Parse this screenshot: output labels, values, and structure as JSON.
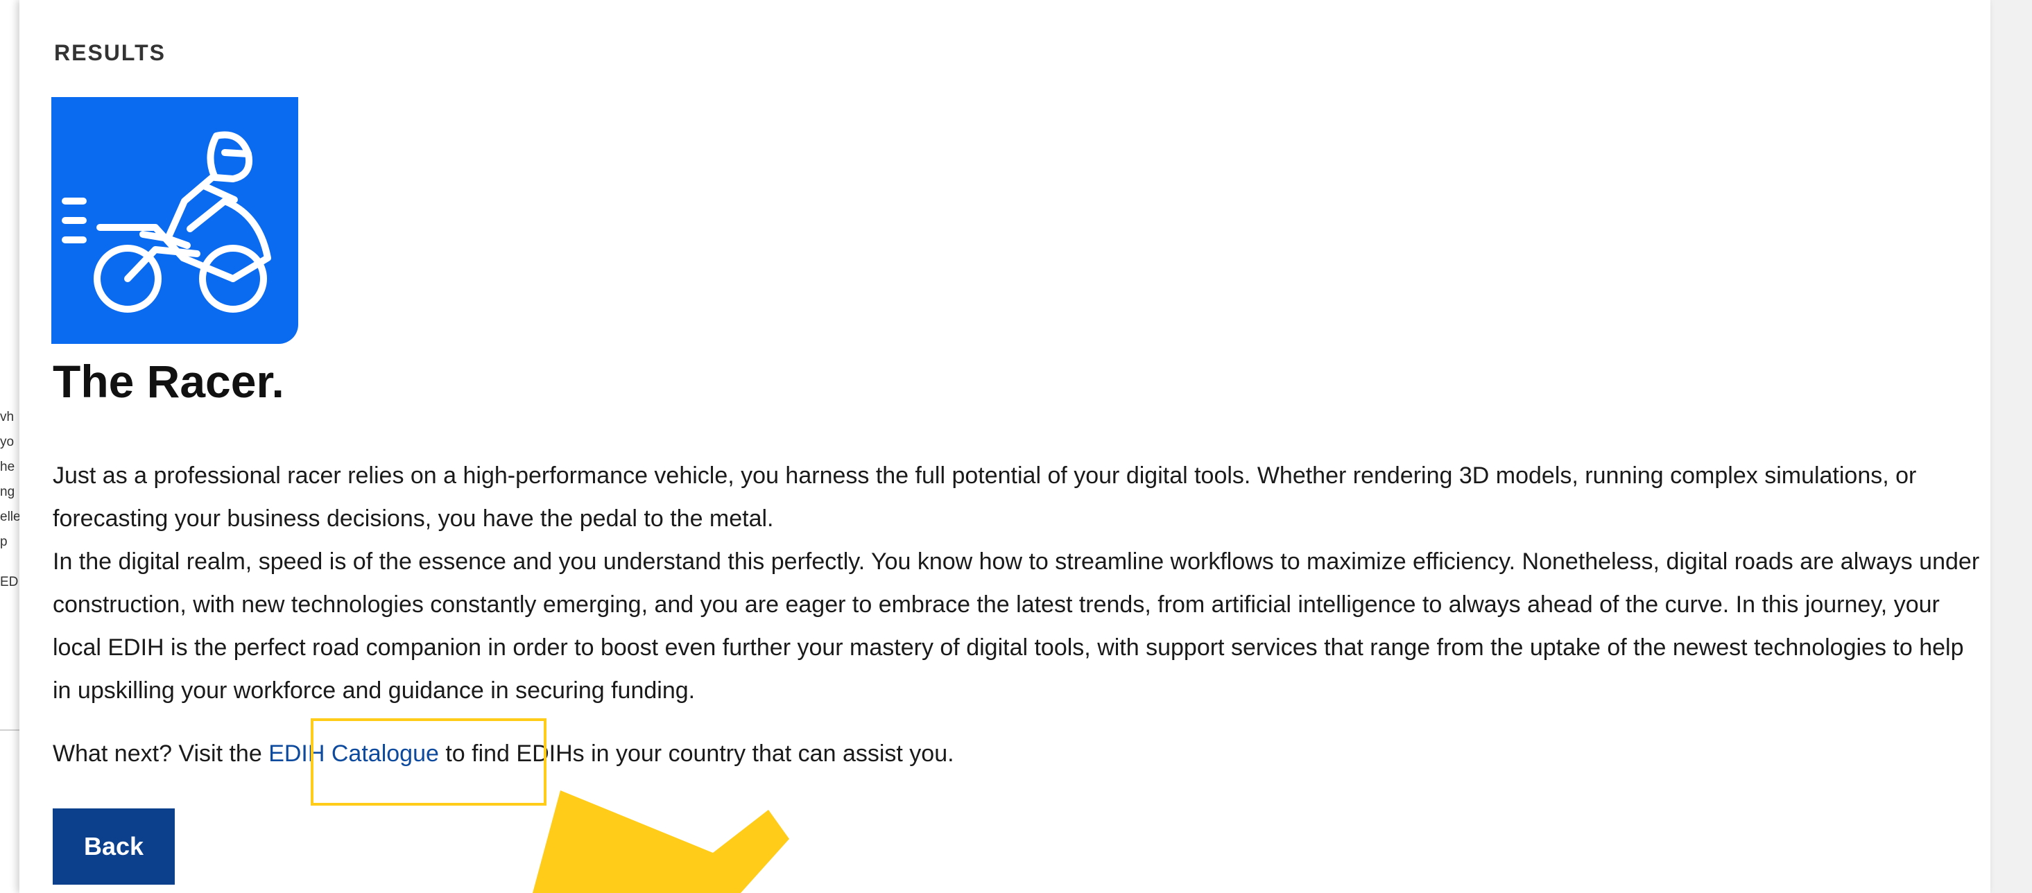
{
  "backdrop": {
    "fragments": [
      "vh",
      "yo",
      "he",
      "ng",
      "elle",
      "p",
      "ED"
    ]
  },
  "modal": {
    "heading": "RESULTS",
    "badge_icon": "motorcycle-racer-icon",
    "title": "The Racer.",
    "paragraphs": [
      "Just as a professional racer relies on a high-performance vehicle, you harness the full potential of your digital tools. Whether rendering 3D models, running complex simulations, or forecasting your business decisions, you have the pedal to the metal.",
      "In the digital realm, speed is of the essence and you understand this perfectly. You know how to streamline workflows to maximize efficiency. Nonetheless, digital roads are always under construction, with new technologies constantly emerging, and you are eager to embrace the latest trends, from artificial intelligence to always ahead of the curve. In this journey, your local EDIH is the perfect road companion in order to boost even further your mastery of digital tools, with support services that range from the uptake of the newest technologies to help in upskilling your workforce and guidance in securing funding."
    ],
    "next_prefix": "What next? Visit the ",
    "next_link": "EDIH Catalogue",
    "next_suffix": " to find EDIHs in your country that can assist you.",
    "back_button": "Back"
  },
  "annotation": {
    "highlight_color": "#ffcc1a"
  },
  "colors": {
    "badge": "#0a6af0",
    "button": "#0c3f8c",
    "link": "#0d4a9e"
  }
}
